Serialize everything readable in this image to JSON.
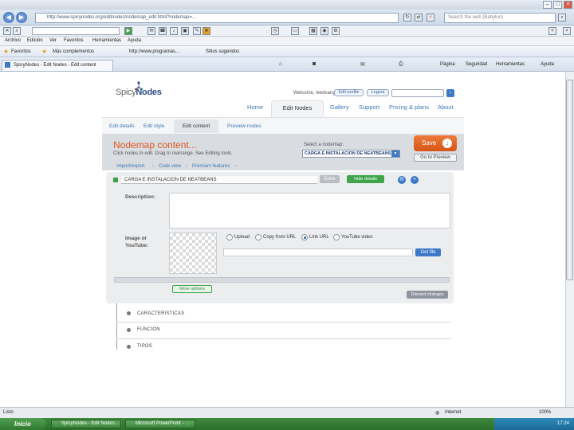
{
  "browser": {
    "address": "http://www.spicynodes.org/editnodes/nodemap_edit.html?nodemap=...",
    "search_placeholder": "Search the web (Babylon)",
    "menu": [
      "Archivo",
      "Edición",
      "Ver",
      "Favoritos",
      "Herramientas",
      "Ayuda"
    ],
    "favorites_label": "Favoritos",
    "fav_links": [
      "Más complementos",
      "http://www.programas...",
      "Sitios sugeridos"
    ],
    "tab_title": "SpicyNodes - Edit Nodes - Edit content",
    "tab_tools": [
      "Página",
      "Seguridad",
      "Herramientas",
      "Ayuda"
    ],
    "status_left": "Listo",
    "status_zone": "Internet",
    "status_zoom": "100%"
  },
  "taskbar": {
    "start": "Inicio",
    "items": [
      "SpicyNodes - Edit Nodes...",
      "Microsoft PowerPoint - ..."
    ],
    "clock": "17:24"
  },
  "header": {
    "logo_main": "Spicy",
    "logo_accent": "Nodes",
    "welcome": "Welcome, leedvany",
    "edit_profile": "Edit profile",
    "logout": "Logout",
    "nav": {
      "home": "Home",
      "edit_nodes": "Edit Nodes",
      "gallery": "Gallery",
      "support": "Support",
      "pricing": "Pricing & plans",
      "about": "About"
    }
  },
  "subnav": {
    "edit_details": "Edit details",
    "edit_style": "Edit style",
    "edit_content": "Edit content",
    "preview_nodes": "Preview nodes"
  },
  "content_header": {
    "title": "Nodemap content...",
    "subtitle": "Click nodes to edit. Drag to rearrange. See Editing tools.",
    "select_label": "Select a nodemap:",
    "selected_nodemap": "CARGA E INSTALACION DE NEATBEANS",
    "save": "Save",
    "go_preview": "Go to Preview"
  },
  "tools": {
    "import_export": "Import/export",
    "code_view": "Code view",
    "premium": "Premium features"
  },
  "editor": {
    "node_title": "CARGA E INSTALACION DE NEATBEANS",
    "done": "Done",
    "hide_details": "Hide details",
    "description_label": "Description:",
    "image_label_1": "Image or",
    "image_label_2": "YouTube:",
    "radio_upload": "Upload",
    "radio_copy": "Copy from URL",
    "radio_link": "Link URL",
    "radio_youtube": "YouTube video",
    "get_file": "Get file",
    "more_options": "More options",
    "discard": "Discard changes"
  },
  "tree": {
    "items": [
      "CARACTERISTICAS",
      "FUNCION",
      "TIPOS"
    ]
  }
}
